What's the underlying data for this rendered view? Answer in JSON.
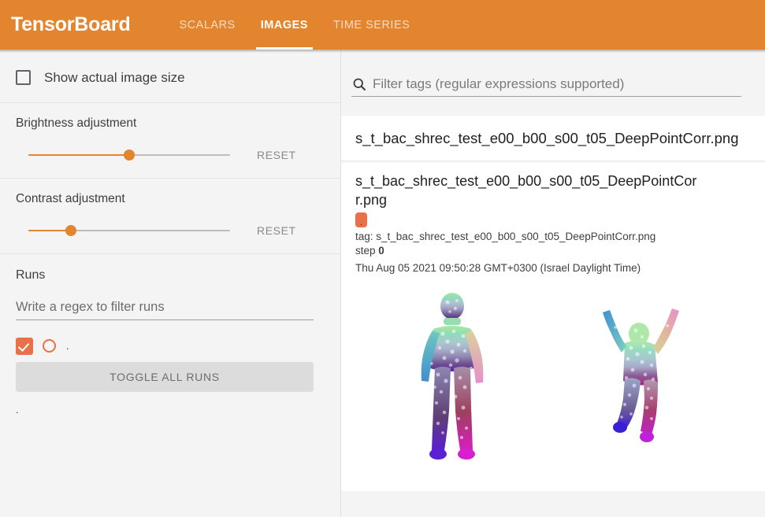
{
  "header": {
    "brand": "TensorBoard",
    "tabs": [
      {
        "label": "SCALARS",
        "active": false
      },
      {
        "label": "IMAGES",
        "active": true
      },
      {
        "label": "TIME SERIES",
        "active": false
      }
    ],
    "background_color": "#e2852e"
  },
  "sidebar": {
    "show_actual_size": {
      "label": "Show actual image size",
      "checked": false
    },
    "brightness": {
      "title": "Brightness adjustment",
      "reset_label": "RESET",
      "value_percent": 50
    },
    "contrast": {
      "title": "Contrast adjustment",
      "reset_label": "RESET",
      "value_percent": 21
    },
    "runs": {
      "title": "Runs",
      "filter_placeholder": "Write a regex to filter runs",
      "filter_value": "",
      "items": [
        {
          "name": ".",
          "checked": true,
          "color": "#e8714a"
        }
      ],
      "toggle_all_label": "TOGGLE ALL RUNS",
      "footer_text": "."
    },
    "accent_color": "#e2852e",
    "run_color": "#e8714a"
  },
  "main": {
    "filter": {
      "placeholder": "Filter tags (regular expressions supported)",
      "value": "",
      "icon": "search-icon"
    },
    "card": {
      "header_title": "s_t_bac_shrec_test_e00_b00_s00_t05_DeepPointCorr.png",
      "tag_title": "s_t_bac_shrec_test_e00_b00_s00_t05_DeepPointCorr.png",
      "run_badge_label": ".",
      "tag_line_prefix": "tag: ",
      "tag_line_value": "s_t_bac_shrec_test_e00_b00_s00_t05_DeepPointCorr.png",
      "step_label": "step ",
      "step_value": "0",
      "timestamp": "Thu Aug 05 2021 09:50:28 GMT+0300 (Israel Daylight Time)",
      "image_alt_left": "human point cloud standing pose colored by correspondence",
      "image_alt_right": "human point cloud arms-raised pose colored by correspondence"
    }
  }
}
